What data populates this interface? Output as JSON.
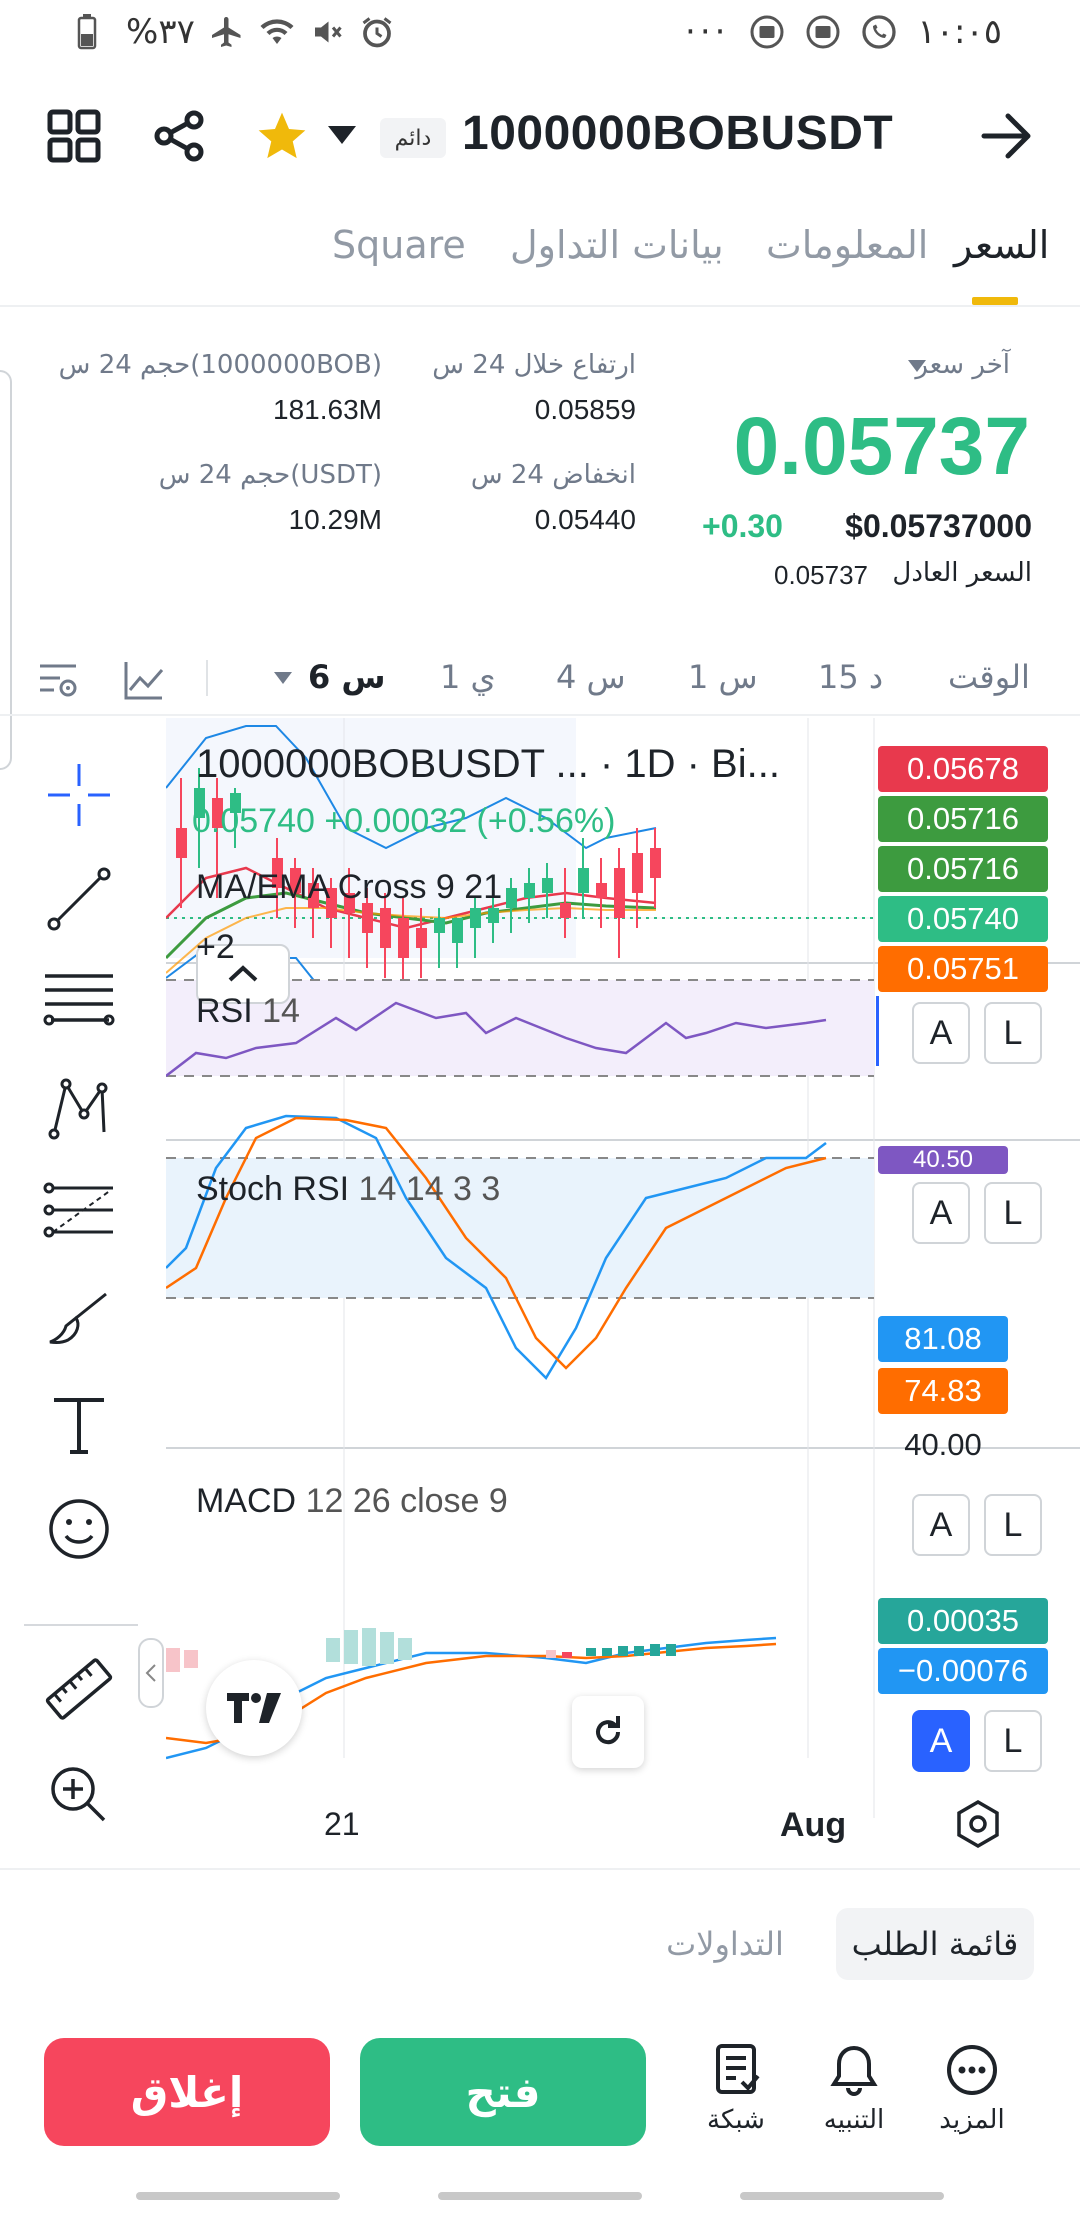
{
  "status_bar": {
    "battery_percent": "%٣٧",
    "clock": "١٠:٠٥",
    "dots": "···"
  },
  "header": {
    "symbol": "1000000BOBUSDT",
    "perpetual_badge": "دائم"
  },
  "tabs": [
    {
      "label": "السعر",
      "active": true
    },
    {
      "label": "المعلومات",
      "active": false
    },
    {
      "label": "بيانات التداول",
      "active": false
    },
    {
      "label": "Square",
      "active": false
    }
  ],
  "price_info": {
    "last_price_label": "آخر سعر",
    "last_price": "0.05737",
    "change_pct": "+0.30",
    "usd_price": "$0.05737000",
    "fair_price_label": "السعر العادل",
    "fair_price": "0.05737",
    "high_label": "ارتفاع خلال 24 س",
    "high": "0.05859",
    "low_label": "انخفاض 24 س",
    "low": "0.05440",
    "vol_base_label": "حجم 24 س(1000000BOB)",
    "vol_base": "181.63M",
    "vol_quote_label": "حجم 24 س(USDT)",
    "vol_quote": "10.29M"
  },
  "intervals": {
    "time_label": "الوقت",
    "items": [
      "15 د",
      "1 س",
      "4 س",
      "1 ي",
      "6 س"
    ],
    "active": "6 س"
  },
  "chart": {
    "main_title": "1000000BOBUSDT ... · 1D · Bi...",
    "ohlc_line": "0.05740  +0.00032 (+0.56%)",
    "indicator_ma": "MA/EMA Cross 9 21",
    "more_indicators": "+2",
    "price_labels": [
      {
        "text": "0.05678",
        "color": "#e8394d"
      },
      {
        "text": "0.05716",
        "color": "#3d9b3f"
      },
      {
        "text": "0.05716",
        "color": "#3d9b3f"
      },
      {
        "text": "0.05740",
        "color": "#2ebd85"
      },
      {
        "text": "0.05751",
        "color": "#ff6d00"
      }
    ],
    "rsi_title": "RSI",
    "rsi_param": "14",
    "rsi_value": "40.50",
    "stoch_title": "Stoch RSI",
    "stoch_params": "14 14 3 3",
    "stoch_k": "81.08",
    "stoch_d": "74.83",
    "stoch_level": "40.00",
    "macd_title": "MACD",
    "macd_params": "12 26 close 9",
    "macd_value": "0.00035",
    "macd_signal": "−0.00076",
    "x_labels": [
      "21",
      "Aug"
    ],
    "alert_label": "A",
    "log_label": "L"
  },
  "orderbook_tabs": {
    "order_book": "قائمة الطلب",
    "trades": "التداولات"
  },
  "bottom": {
    "close_label": "إغلاق",
    "open_label": "فتح",
    "grid_label": "شبكة",
    "alert_label": "التنبيه",
    "more_label": "المزيد"
  },
  "colors": {
    "green": "#2ebd85",
    "red": "#f6465d",
    "yellow": "#f0b90b",
    "blue": "#2962ff",
    "orange": "#ff6d00"
  }
}
